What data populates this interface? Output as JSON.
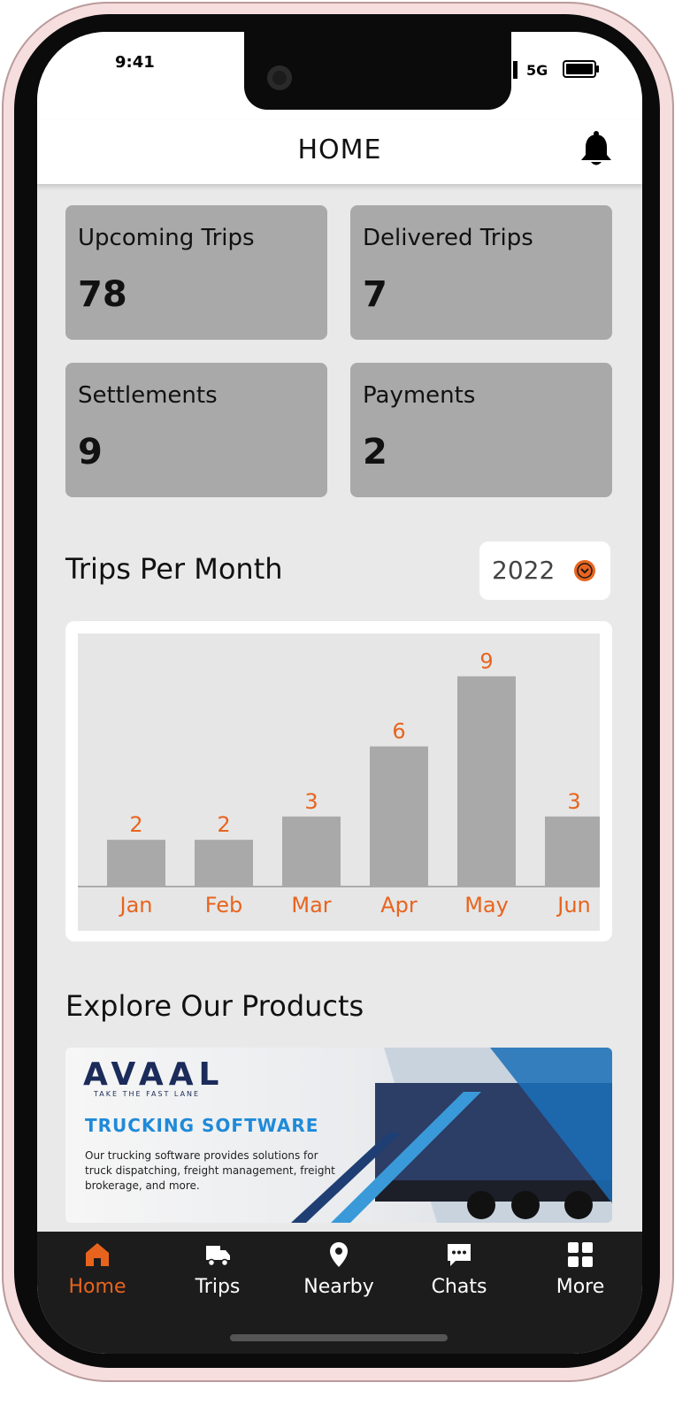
{
  "status": {
    "time": "9:41",
    "network": "5G"
  },
  "header": {
    "title": "HOME"
  },
  "stats": [
    {
      "label": "Upcoming Trips",
      "value": "78"
    },
    {
      "label": "Delivered Trips",
      "value": "7"
    },
    {
      "label": "Settlements",
      "value": "9"
    },
    {
      "label": "Payments",
      "value": "2"
    }
  ],
  "trips_section": {
    "title": "Trips Per Month",
    "year": "2022"
  },
  "chart_data": {
    "type": "bar",
    "categories": [
      "Jan",
      "Feb",
      "Mar",
      "Apr",
      "May",
      "Jun"
    ],
    "values": [
      2,
      2,
      3,
      6,
      9,
      3
    ],
    "title": "Trips Per Month",
    "xlabel": "",
    "ylabel": "",
    "ylim": [
      0,
      10
    ],
    "bar_color": "#a9a9a9",
    "label_color": "#e8641e"
  },
  "products_section": {
    "title": "Explore Our Products"
  },
  "banner": {
    "brand": "AVAAL",
    "tagline": "TAKE THE FAST LANE",
    "heading": "TRUCKING SOFTWARE",
    "body": "Our trucking software provides solutions for truck dispatching, freight management, freight brokerage, and more."
  },
  "tabs": [
    {
      "label": "Home",
      "icon": "home-icon",
      "active": true
    },
    {
      "label": "Trips",
      "icon": "truck-icon",
      "active": false
    },
    {
      "label": "Nearby",
      "icon": "location-pin-icon",
      "active": false
    },
    {
      "label": "Chats",
      "icon": "chat-icon",
      "active": false
    },
    {
      "label": "More",
      "icon": "grid-icon",
      "active": false
    }
  ],
  "colors": {
    "accent": "#e8641e",
    "card": "#a9a9a9",
    "tabbar": "#1c1c1c",
    "background": "#e9e9e9"
  }
}
